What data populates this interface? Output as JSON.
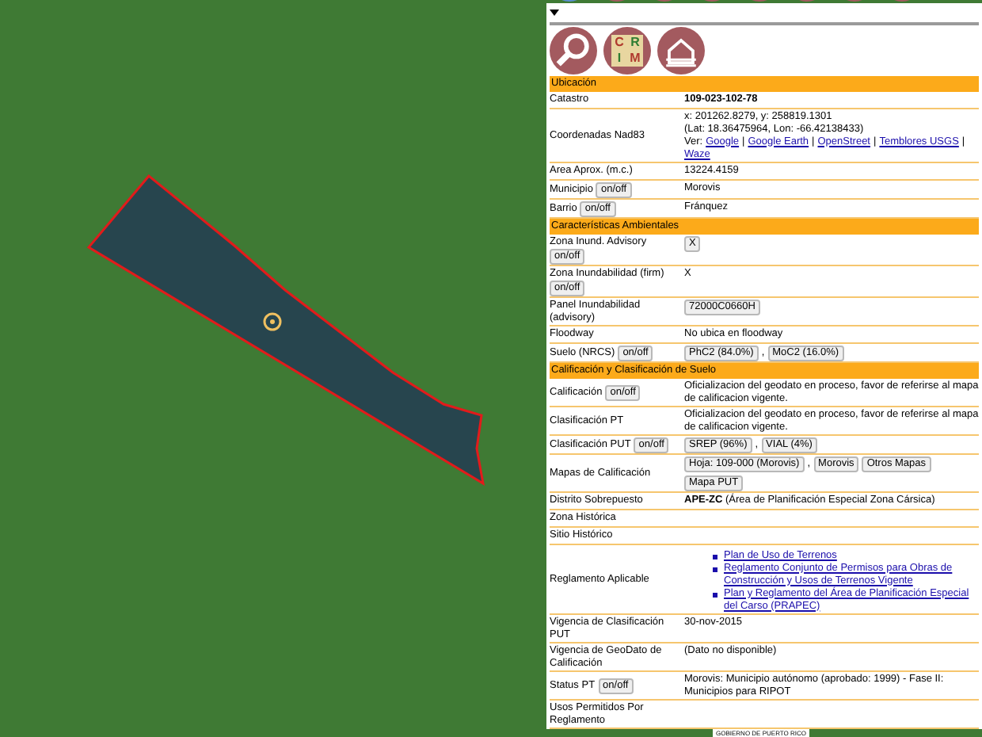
{
  "panel": {
    "logo": [
      "C",
      "R",
      "I",
      "M"
    ],
    "sections": [
      {
        "title": "Ubicación",
        "rows": [
          {
            "label": "Catastro",
            "parts": [
              {
                "kind": "strong",
                "text": "109-023-102-78"
              }
            ]
          },
          {
            "label": "Coordenadas Nad83",
            "parts": [
              {
                "kind": "text",
                "text": "x: 201262.8279, y: 258819.1301"
              },
              {
                "kind": "text",
                "text": "(Lat: 18.36475964, Lon: -66.42138433)"
              },
              {
                "kind": "links",
                "prefix": "Ver:",
                "separator": "|",
                "items": [
                  "Google",
                  "Google Earth",
                  "OpenStreet",
                  "Temblores USGS",
                  "Waze"
                ]
              }
            ]
          },
          {
            "label": "Area Aprox. (m.c.)",
            "parts": [
              {
                "kind": "text",
                "text": "13224.4159"
              }
            ]
          },
          {
            "label": "Municipio",
            "toggle": "on/off",
            "parts": [
              {
                "kind": "text",
                "text": "Morovis"
              }
            ]
          },
          {
            "label": "Barrio",
            "toggle": "on/off",
            "parts": [
              {
                "kind": "text",
                "text": "Fránquez"
              }
            ]
          }
        ]
      },
      {
        "title": "Características Ambientales",
        "rows": [
          {
            "label": "Zona Inund. Advisory",
            "toggle": "on/off",
            "parts": [
              {
                "kind": "buttons",
                "items": [
                  "X"
                ]
              }
            ]
          },
          {
            "label": "Zona Inundabilidad (firm)",
            "toggle": "on/off",
            "parts": [
              {
                "kind": "text",
                "text": "X"
              }
            ]
          },
          {
            "label": "Panel Inundabilidad (advisory)",
            "parts": [
              {
                "kind": "buttons",
                "items": [
                  "72000C0660H"
                ]
              }
            ]
          },
          {
            "label": "Floodway",
            "parts": [
              {
                "kind": "text",
                "text": "No ubica en floodway"
              }
            ]
          },
          {
            "label": "Suelo (NRCS)",
            "toggle": "on/off",
            "parts": [
              {
                "kind": "buttons",
                "separator": ",",
                "items": [
                  "PhC2 (84.0%)",
                  "MoC2 (16.0%)"
                ]
              }
            ]
          }
        ]
      },
      {
        "title": "Calificación y Clasificación de Suelo",
        "rows": [
          {
            "label": "Calificación",
            "toggle": "on/off",
            "parts": [
              {
                "kind": "text",
                "text": "Oficializacion del geodato en proceso, favor de referirse al mapa de calificacion vigente."
              }
            ]
          },
          {
            "label": "Clasificación PT",
            "parts": [
              {
                "kind": "text",
                "text": "Oficializacion del geodato en proceso, favor de referirse al mapa de calificacion vigente."
              }
            ]
          },
          {
            "label": "Clasificación PUT",
            "toggle": "on/off",
            "parts": [
              {
                "kind": "buttons",
                "separator": ",",
                "items": [
                  "SREP (96%)",
                  "VIAL (4%)"
                ]
              }
            ]
          },
          {
            "label": "Mapas de Calificación",
            "parts": [
              {
                "kind": "buttons",
                "separator": ",",
                "items": [
                  "Hoja: 109-000 (Morovis)",
                  "Morovis",
                  "Otros Mapas",
                  "Mapa PUT"
                ]
              }
            ]
          },
          {
            "label": "Distrito Sobrepuesto",
            "parts": [
              {
                "kind": "text",
                "text": "**APE-ZC** (Área de Planificación Especial Zona Cársica)"
              }
            ]
          },
          {
            "label": "Zona Histórica",
            "parts": []
          },
          {
            "label": "Sitio Histórico",
            "parts": []
          },
          {
            "label": "Reglamento Aplicable",
            "parts": [
              {
                "kind": "bullets",
                "items": [
                  "Plan de Uso de Terrenos",
                  "Reglamento Conjunto de Permisos para Obras de Construcción y Usos de Terrenos Vigente",
                  "Plan y Reglamento del Área de Planificación Especial del Carso (PRAPEC)"
                ]
              }
            ]
          },
          {
            "label": "Vigencia de Clasificación PUT",
            "parts": [
              {
                "kind": "text",
                "text": "30-nov-2015"
              }
            ]
          },
          {
            "label": "Vigencia de GeoDato de Calificación",
            "parts": [
              {
                "kind": "text",
                "text": "(Dato no disponible)"
              }
            ]
          },
          {
            "label": "Status PT",
            "toggle": "on/off",
            "parts": [
              {
                "kind": "text",
                "text": "Morovis: Municipio autónomo (aprobado: 1999) - Fase II: Municipios para RIPOT"
              }
            ]
          },
          {
            "label": "Usos Permitidos Por Reglamento",
            "parts": []
          }
        ]
      }
    ]
  },
  "footer": "GOBIERNO DE PUERTO RICO"
}
